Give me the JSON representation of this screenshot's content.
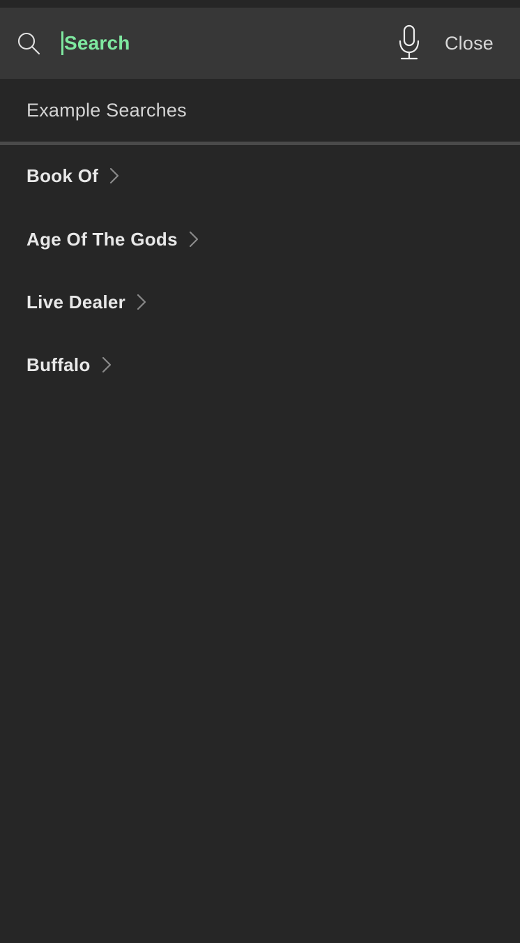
{
  "theme": {
    "page_bg": "#262626",
    "header_bg": "#373737",
    "divider": "#4A4A4A",
    "accent_green": "#7FE8A0",
    "text_primary": "#E8E8E8",
    "text_secondary": "#D4D4D4",
    "chevron": "#8A8A8A"
  },
  "search_header": {
    "search_icon": "search-icon",
    "input_value": "Search",
    "input_placeholder": "Search",
    "mic_icon": "microphone-icon",
    "close_label": "Close"
  },
  "section": {
    "title": "Example Searches"
  },
  "suggestions": [
    {
      "label": "Book Of",
      "chevron": "chevron-right-icon"
    },
    {
      "label": "Age Of The Gods",
      "chevron": "chevron-right-icon"
    },
    {
      "label": "Live Dealer",
      "chevron": "chevron-right-icon"
    },
    {
      "label": "Buffalo",
      "chevron": "chevron-right-icon"
    }
  ]
}
